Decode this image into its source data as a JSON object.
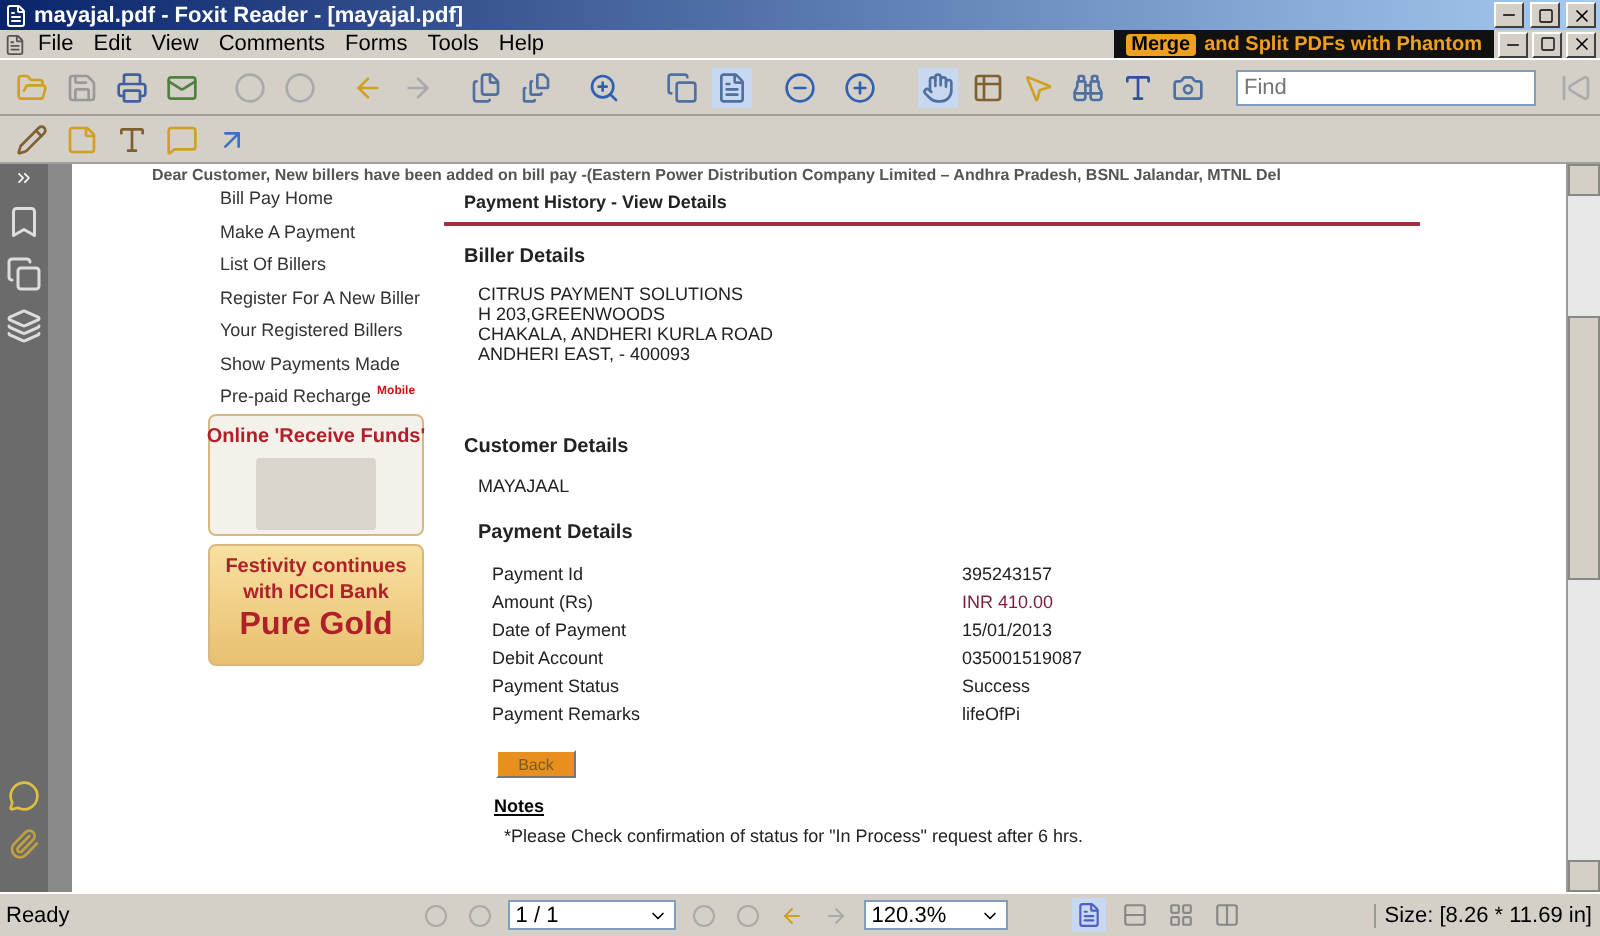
{
  "window": {
    "title": "mayajal.pdf - Foxit Reader - [mayajal.pdf]"
  },
  "menu": [
    "File",
    "Edit",
    "View",
    "Comments",
    "Forms",
    "Tools",
    "Help"
  ],
  "ad_banner": {
    "highlight": "Merge",
    "text": "and Split PDFs with Phantom"
  },
  "find": {
    "placeholder": "Find"
  },
  "document": {
    "notice": "Dear Customer, New billers have been added on bill pay -(Eastern Power Distribution Company Limited – Andhra Pradesh, BSNL Jalandar, MTNL Del",
    "nav": [
      {
        "label": "Bill Pay Home"
      },
      {
        "label": "Make A Payment"
      },
      {
        "label": "List Of Billers"
      },
      {
        "label": "Register For A New Biller"
      },
      {
        "label": "Your Registered Billers"
      },
      {
        "label": "Show Payments Made"
      },
      {
        "label": "Pre-paid Recharge",
        "badge": "Mobile"
      }
    ],
    "promos": [
      {
        "kind": "photo",
        "lines": [
          "Online 'Receive Funds'"
        ]
      },
      {
        "kind": "gold",
        "lines": [
          "Festivity continues",
          "with ICICI Bank",
          "Pure Gold"
        ]
      }
    ],
    "heading": "Payment History - View Details",
    "biller": {
      "title": "Biller Details",
      "lines": [
        "CITRUS PAYMENT SOLUTIONS",
        "H 203,GREENWOODS",
        "CHAKALA, ANDHERI KURLA ROAD",
        "ANDHERI EAST, - 400093"
      ]
    },
    "customer": {
      "title": "Customer Details",
      "name": "MAYAJAAL"
    },
    "payment": {
      "title": "Payment Details",
      "rows": [
        {
          "label": "Payment Id",
          "value": "395243157",
          "color": "#222222"
        },
        {
          "label": "Amount (Rs)",
          "value": "INR 410.00",
          "color": "#7a1f3a"
        },
        {
          "label": "Date of Payment",
          "value": "15/01/2013",
          "color": "#222222"
        },
        {
          "label": "Debit Account",
          "value": "035001519087",
          "color": "#222222"
        },
        {
          "label": "Payment Status",
          "value": "Success",
          "color": "#222222"
        },
        {
          "label": "Payment Remarks",
          "value": "lifeOfPi",
          "color": "#222222"
        }
      ]
    },
    "back_button": "Back",
    "notes": {
      "title": "Notes",
      "text": "*Please Check confirmation of status for \"In Process\" request after 6 hrs."
    }
  },
  "status_bar": {
    "state": "Ready",
    "page": "1 / 1",
    "zoom": "120.3%",
    "size": "Size: [8.26 * 11.69 in]"
  }
}
